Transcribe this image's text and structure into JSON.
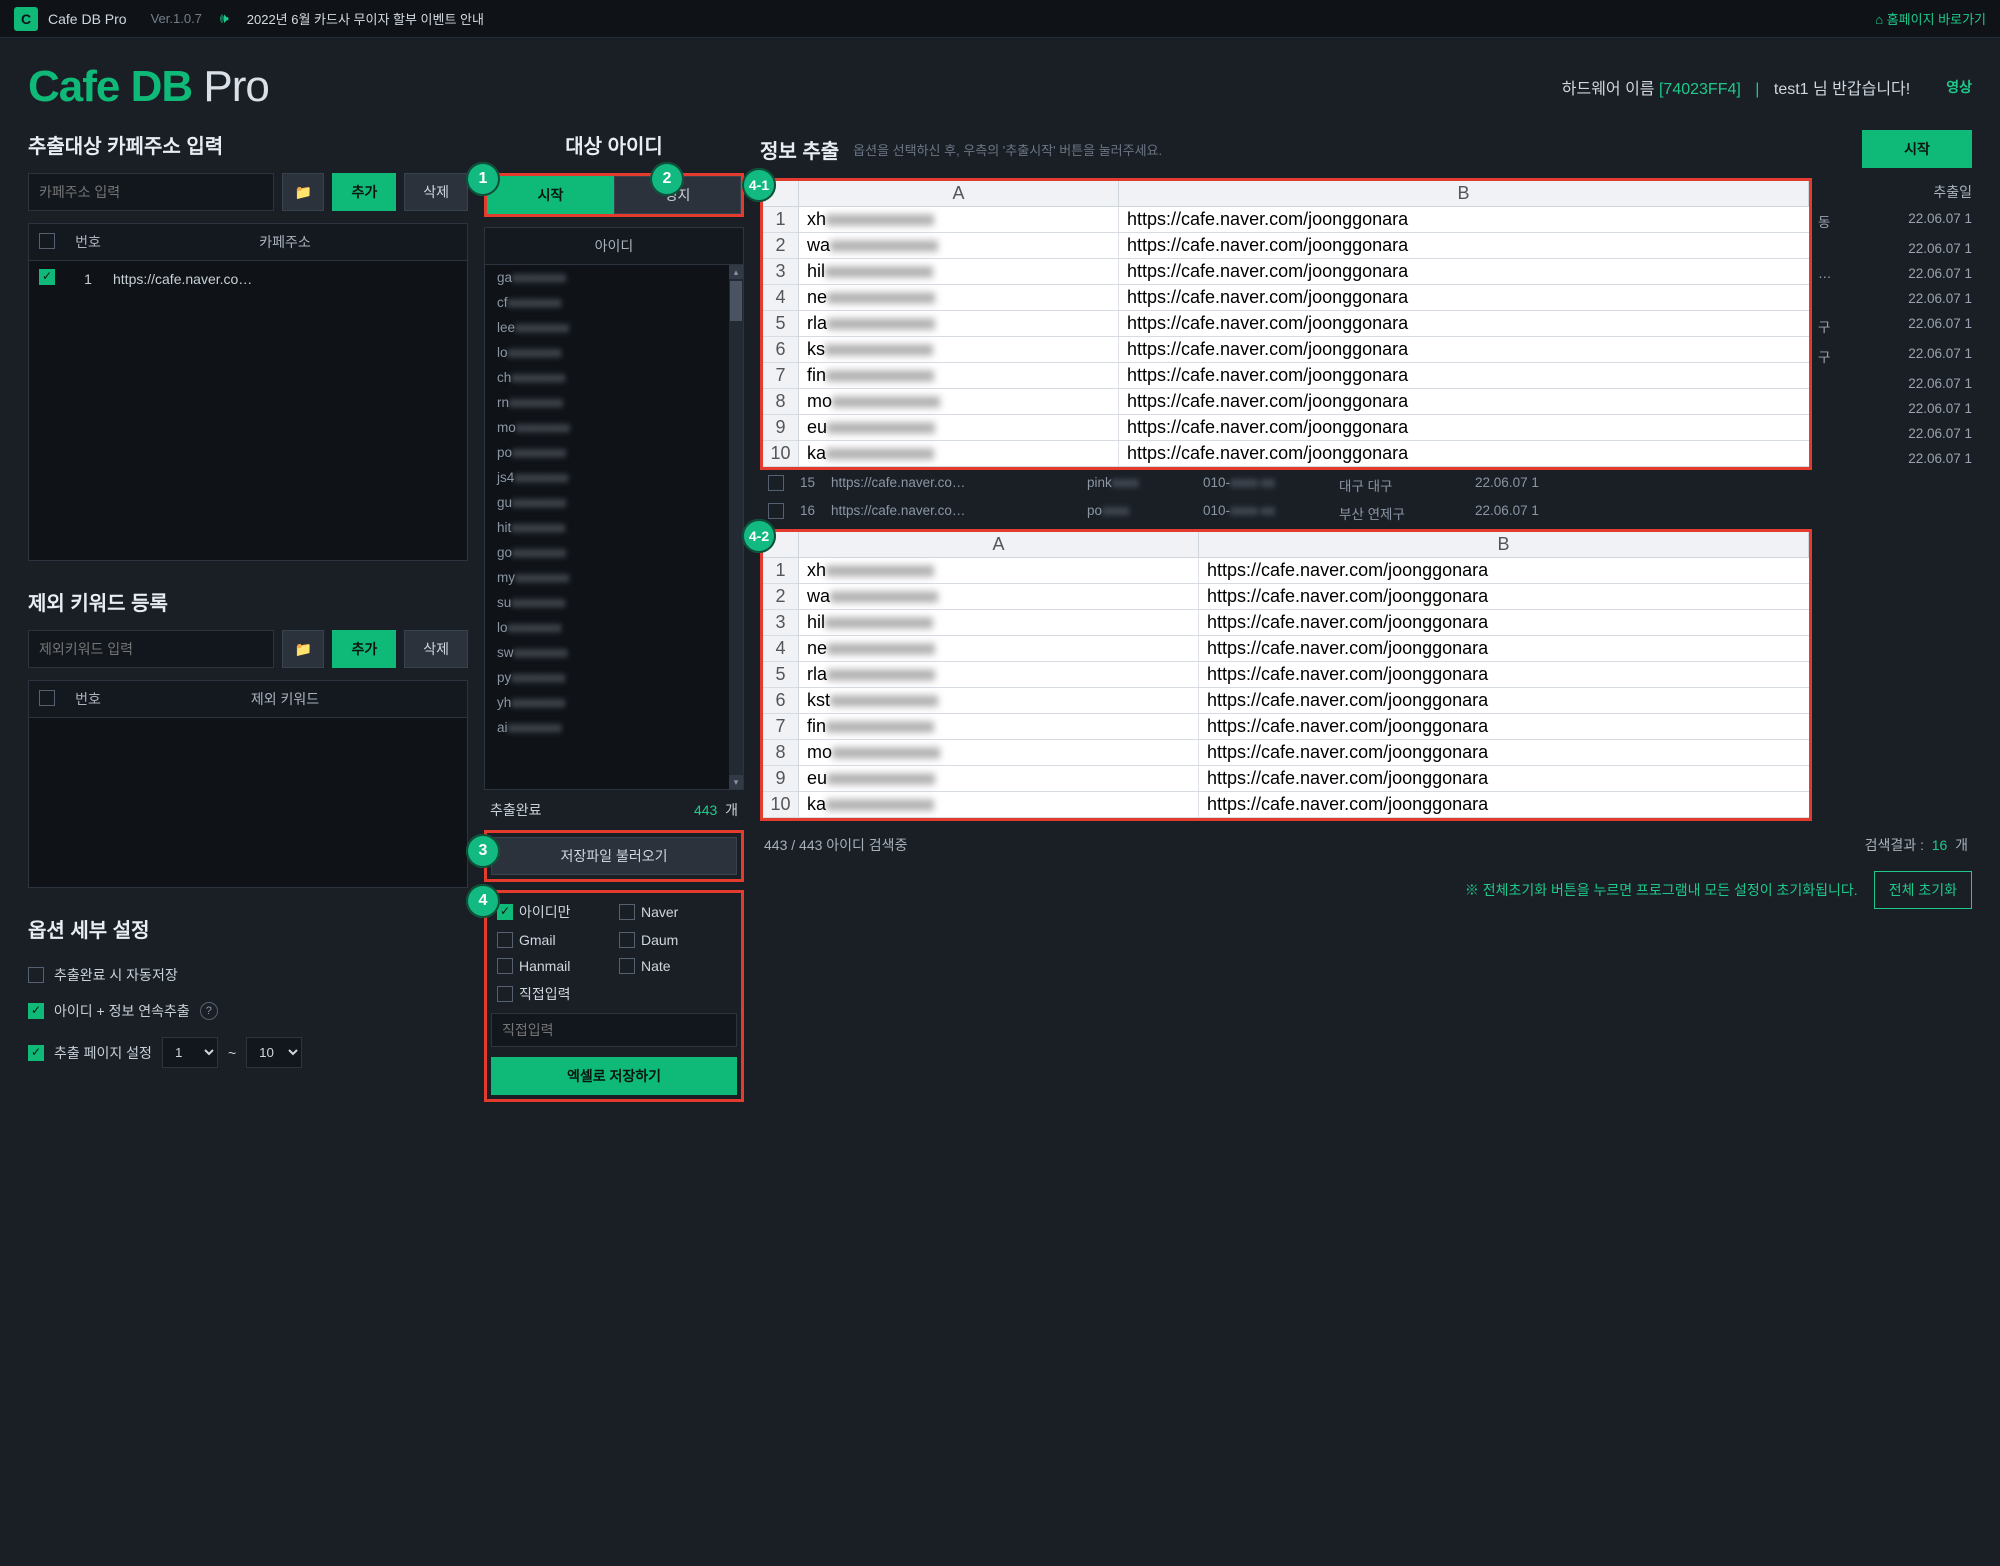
{
  "topbar": {
    "app_name": "Cafe DB Pro",
    "version": "Ver.1.0.7",
    "announcement": "2022년 6월 카드사 무이자 할부 이벤트 안내",
    "home": "홈페이지 바로가기"
  },
  "logo": {
    "part1": "Cafe DB",
    "part2": " Pro"
  },
  "header": {
    "hw_label": "하드웨어 이름",
    "hw_id": "[74023FF4]",
    "user": "test1",
    "welcome": "님 반갑습니다!",
    "extra": "영상"
  },
  "left": {
    "cafe_title": "추출대상 카페주소 입력",
    "cafe_placeholder": "카페주소 입력",
    "add": "추가",
    "delete": "삭제",
    "col_num": "번호",
    "col_addr": "카페주소",
    "rows": [
      {
        "num": "1",
        "url": "https://cafe.naver.co…"
      }
    ],
    "ex_title": "제외 키워드 등록",
    "ex_placeholder": "제외키워드 입력",
    "col_ex": "제외 키워드",
    "opt_title": "옵션 세부 설정",
    "opt_auto": "추출완료 시 자동저장",
    "opt_chain": "아이디 + 정보 연속추출",
    "opt_page": "추출 페이지 설정",
    "page_from": "1",
    "page_to": "10"
  },
  "target": {
    "title": "대상 아이디",
    "start": "시작",
    "stop": "정지",
    "col_id": "아이디",
    "ids": [
      "ga",
      "cf",
      "lee",
      "lo",
      "ch",
      "rn",
      "mo",
      "po",
      "js4",
      "gu",
      "hit",
      "go",
      "my",
      "su",
      "lo",
      "sw",
      "py",
      "yh",
      "ai"
    ],
    "done_label": "추출완료",
    "done_count": "443",
    "done_unit": "개",
    "load_file": "저장파일 불러오기",
    "filters": {
      "id_only": "아이디만",
      "naver": "Naver",
      "gmail": "Gmail",
      "daum": "Daum",
      "hanmail": "Hanmail",
      "nate": "Nate",
      "direct": "직접입력",
      "direct_ph": "직접입력"
    },
    "save_excel": "엑셀로 저장하기"
  },
  "info": {
    "title": "정보 추출",
    "hint": "옵션을 선택하신 후, 우측의 '추출시작' 버튼을 눌러주세요.",
    "start": "시작",
    "col_date_head": "추출일",
    "default_url": "https://cafe.naver.com/joonggonara",
    "excel1": {
      "colA_w": 320,
      "rows": [
        {
          "a": "xh",
          "b": "https://cafe.naver.com/joonggonara"
        },
        {
          "a": "wa",
          "b": "https://cafe.naver.com/joonggonara"
        },
        {
          "a": "hil",
          "b": "https://cafe.naver.com/joonggonara"
        },
        {
          "a": "ne",
          "b": "https://cafe.naver.com/joonggonara"
        },
        {
          "a": "rla",
          "b": "https://cafe.naver.com/joonggonara"
        },
        {
          "a": "ks",
          "b": "https://cafe.naver.com/joonggonara"
        },
        {
          "a": "fin",
          "b": "https://cafe.naver.com/joonggonara"
        },
        {
          "a": "mo",
          "b": "https://cafe.naver.com/joonggonara"
        },
        {
          "a": "eu",
          "b": "https://cafe.naver.com/joonggonara"
        },
        {
          "a": "ka",
          "b": "https://cafe.naver.com/joonggonara"
        }
      ]
    },
    "between": [
      {
        "n": "15",
        "url": "https://cafe.naver.co…",
        "id": "pink",
        "tel": "010-",
        "loc": "대구 대구",
        "dt": "22.06.07 1"
      },
      {
        "n": "16",
        "url": "https://cafe.naver.co…",
        "id": "po",
        "tel": "010-",
        "loc": "부산 연제구",
        "dt": "22.06.07 1"
      }
    ],
    "side_dates": [
      "22.06.07 1",
      "22.06.07 1",
      "22.06.07 1",
      "22.06.07 1",
      "22.06.07 1",
      "22.06.07 1",
      "22.06.07 1",
      "22.06.07 1",
      "22.06.07 1",
      "22.06.07 1"
    ],
    "side_locs": [
      "동",
      "",
      "…",
      "",
      "구",
      "구",
      "",
      "",
      "",
      ""
    ],
    "excel2": {
      "colA_w": 400,
      "rows": [
        {
          "a": "xh",
          "b": "https://cafe.naver.com/joonggonara"
        },
        {
          "a": "wa",
          "b": "https://cafe.naver.com/joonggonara"
        },
        {
          "a": "hil",
          "b": "https://cafe.naver.com/joonggonara"
        },
        {
          "a": "ne",
          "b": "https://cafe.naver.com/joonggonara"
        },
        {
          "a": "rla",
          "b": "https://cafe.naver.com/joonggonara"
        },
        {
          "a": "kst",
          "b": "https://cafe.naver.com/joonggonara"
        },
        {
          "a": "fin",
          "b": "https://cafe.naver.com/joonggonara"
        },
        {
          "a": "mo",
          "b": "https://cafe.naver.com/joonggonara"
        },
        {
          "a": "eu",
          "b": "https://cafe.naver.com/joonggonara"
        },
        {
          "a": "ka",
          "b": "https://cafe.naver.com/joonggonara"
        }
      ]
    },
    "status_left": "443 / 443 아이디 검색중",
    "result_label": "검색결과 :",
    "result_count": "16",
    "result_unit": "개",
    "footer_note": "※ 전체초기화 버튼을 누르면 프로그램내 모든 설정이 초기화됩니다.",
    "reset": "전체 초기화"
  },
  "badges": {
    "b1": "1",
    "b2": "2",
    "b3": "3",
    "b4": "4",
    "b41": "4-1",
    "b42": "4-2"
  }
}
